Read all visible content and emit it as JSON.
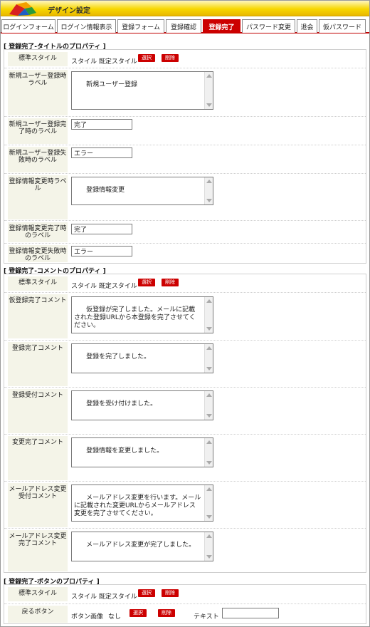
{
  "app": {
    "title": "デザイン設定"
  },
  "tabs": [
    {
      "label": "ログインフォーム"
    },
    {
      "label": "ログイン情報表示"
    },
    {
      "label": "登録フォーム"
    },
    {
      "label": "登録確認"
    },
    {
      "label": "登録完了",
      "active": true
    },
    {
      "label": "パスワード変更"
    },
    {
      "label": "退会"
    },
    {
      "label": "仮パスワード"
    }
  ],
  "colors": {
    "accent": "#cc0000",
    "header": "#f7d700",
    "label_bg": "#f4f4e8"
  },
  "buttons": {
    "select": "選択",
    "delete": "削除"
  },
  "section1": {
    "title": "[ 登録完了-タイトルのプロパティ ]",
    "style_label": "標準スタイル",
    "style_value": "スタイル 既定スタイル",
    "rows": [
      {
        "label": "新規ユーザー登録時ラベル",
        "value": "新規ユーザー登録"
      },
      {
        "label": "新規ユーザー登録完了時のラベル",
        "value": "完了"
      },
      {
        "label": "新規ユーザー登録失敗時のラベル",
        "value": "エラー"
      },
      {
        "label": "登録情報変更時ラベル",
        "value": "登録情報変更"
      },
      {
        "label": "登録情報変更完了時のラベル",
        "value": "完了"
      },
      {
        "label": "登録情報変更失敗時のラベル",
        "value": "エラー"
      }
    ]
  },
  "section2": {
    "title": "[ 登録完了-コメントのプロパティ ]",
    "style_label": "標準スタイル",
    "style_value": "スタイル 既定スタイル",
    "rows": [
      {
        "label": "仮登録完了コメント",
        "value": "仮登録が完了しました。メールに記載された登録URLから本登録を完了させてください。"
      },
      {
        "label": "登録完了コメント",
        "value": "登録を完了しました。"
      },
      {
        "label": "登録受付コメント",
        "value": "登録を受け付けました。"
      },
      {
        "label": "変更完了コメント",
        "value": "登録情報を変更しました。"
      },
      {
        "label": "メールアドレス変更受付コメント",
        "value": "メールアドレス変更を行います。メールに記載された変更URLからメールアドレス変更を完了させてください。"
      },
      {
        "label": "メールアドレス変更完了コメント",
        "value": "メールアドレス変更が完了しました。"
      }
    ]
  },
  "section3": {
    "title": "[ 登録完了-ボタンのプロパティ ]",
    "style_label": "標準スタイル",
    "style_value": "スタイル 既定スタイル",
    "back_label": "戻るボタン",
    "button_image_label": "ボタン画像",
    "button_image_value": "なし",
    "text_label": "テキスト",
    "text_value": ""
  }
}
